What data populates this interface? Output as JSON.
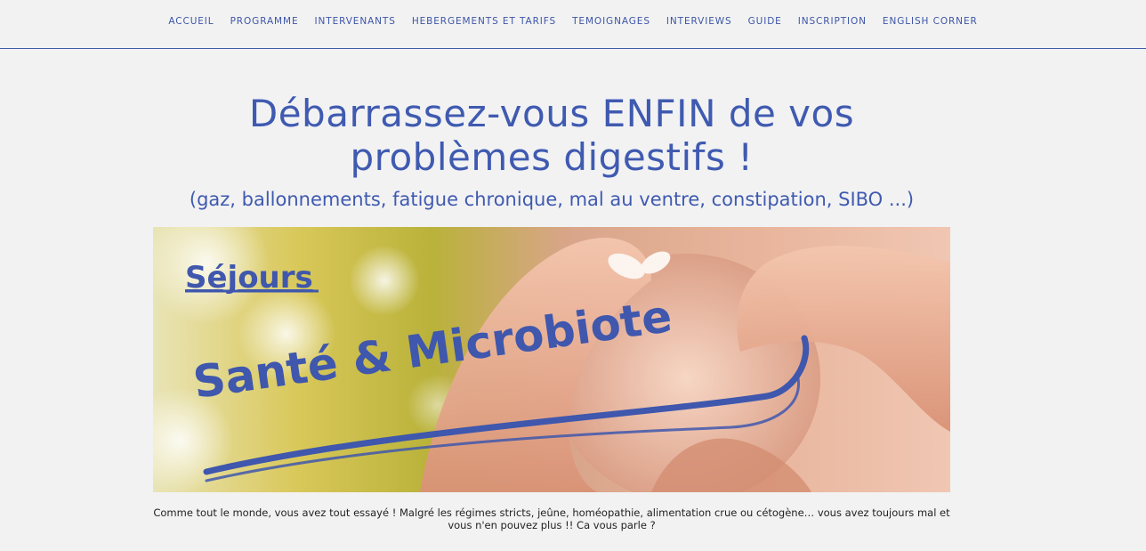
{
  "nav": {
    "items": [
      {
        "label": "ACCUEIL"
      },
      {
        "label": "PROGRAMME"
      },
      {
        "label": "INTERVENANTS"
      },
      {
        "label": "HEBERGEMENTS ET TARIFS"
      },
      {
        "label": "TEMOIGNAGES"
      },
      {
        "label": "INTERVIEWS"
      },
      {
        "label": "GUIDE"
      },
      {
        "label": "INSCRIPTION"
      },
      {
        "label": "ENGLISH CORNER"
      }
    ]
  },
  "hero": {
    "title_line1": "Débarrassez-vous ENFIN de vos",
    "title_line2": "problèmes digestifs !",
    "subtitle": "(gaz, ballonnements, fatigue chronique, mal au ventre, constipation, SIBO ...)"
  },
  "banner": {
    "kicker": "Séjours",
    "title": "Santé & Microbiote"
  },
  "intro": {
    "text": "Comme tout le monde, vous avez tout essayé ! Malgré les régimes stricts, jeûne, homéopathie, alimentation crue ou cétogène… vous avez toujours mal et vous n'en pouvez plus !! Ca vous parle ?"
  },
  "colors": {
    "accent": "#3f5ab0",
    "background": "#f2f2f3",
    "nav_text": "#3d56a6"
  }
}
